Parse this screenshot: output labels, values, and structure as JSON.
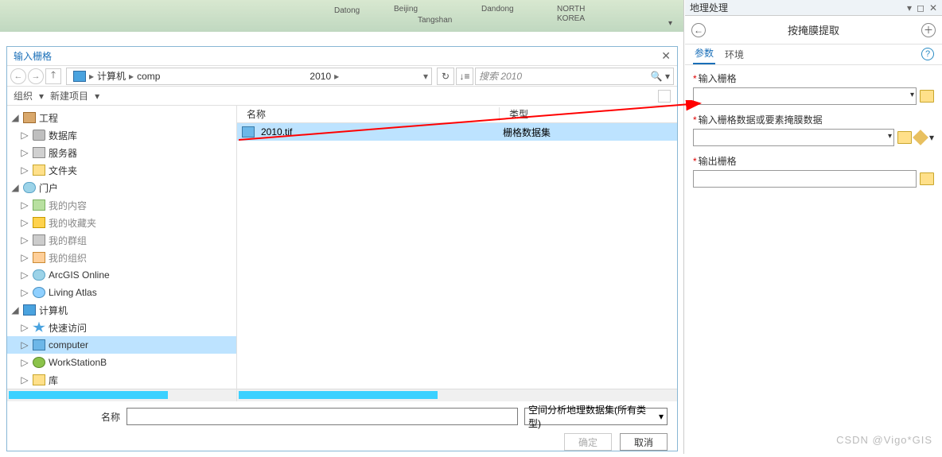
{
  "map_labels": [
    "Datong",
    "Beijing",
    "Tangshan",
    "Dandong",
    "NORTH",
    "KOREA"
  ],
  "dialog": {
    "title": "输入栅格",
    "nav": {
      "crumbs": [
        "计算机",
        "comp",
        "2010"
      ],
      "search_placeholder": "搜索 2010"
    },
    "toolbar": {
      "org": "组织",
      "newitem": "新建项目"
    },
    "tree": {
      "project": "工程",
      "db": "数据库",
      "server": "服务器",
      "folder": "文件夹",
      "portal": "门户",
      "my_content": "我的内容",
      "my_fav": "我的收藏夹",
      "my_group": "我的群组",
      "my_org": "我的组织",
      "arcgis_online": "ArcGIS Online",
      "living_atlas": "Living Atlas",
      "computer_root": "计算机",
      "quick_access": "快速访问",
      "computer": "computer",
      "workstation": "WorkStationB",
      "lib": "库"
    },
    "list": {
      "hdr_name": "名称",
      "hdr_type": "类型",
      "file_name": "2010.tif",
      "file_type": "栅格数据集"
    },
    "bottom": {
      "name_label": "名称",
      "type_select": "空间分析地理数据集(所有类型)",
      "ok": "确定",
      "cancel": "取消"
    }
  },
  "geo": {
    "panel_title": "地理处理",
    "tool_title": "按掩膜提取",
    "tabs": {
      "params": "参数",
      "env": "环境"
    },
    "fields": {
      "in_raster": "输入栅格",
      "in_mask": "输入栅格数据或要素掩膜数据",
      "out_raster": "输出栅格"
    }
  },
  "watermark": "CSDN @Vigo*GIS"
}
